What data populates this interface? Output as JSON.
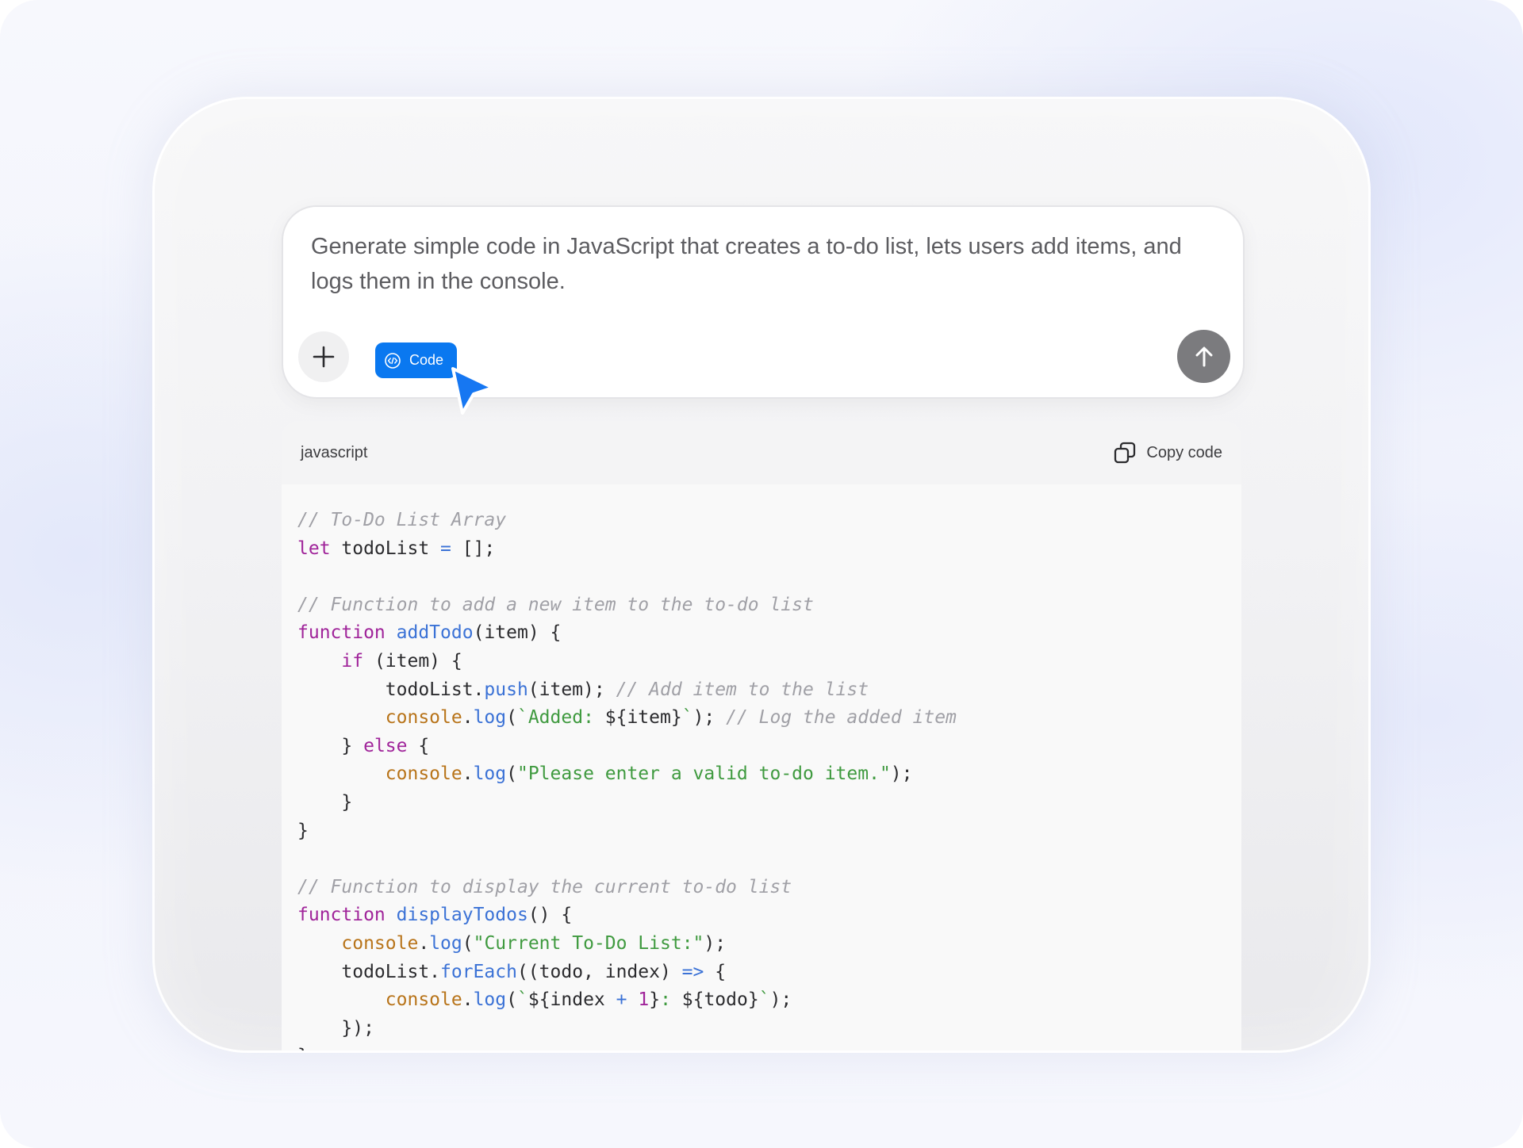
{
  "prompt": {
    "text": "Generate simple code in JavaScript that creates a to-do list, lets users add items, and logs them in the console."
  },
  "toolbar": {
    "chip_label": "Code"
  },
  "code_block": {
    "language": "javascript",
    "copy_label": "Copy code",
    "lines": [
      {
        "tokens": [
          {
            "t": "// To-Do List Array",
            "c": "cm"
          }
        ]
      },
      {
        "tokens": [
          {
            "t": "let",
            "c": "kw"
          },
          {
            "t": " todoList ",
            "c": ""
          },
          {
            "t": "=",
            "c": "op"
          },
          {
            "t": " [];",
            "c": ""
          }
        ]
      },
      {
        "tokens": []
      },
      {
        "tokens": [
          {
            "t": "// Function to add a new item to the to-do list",
            "c": "cm"
          }
        ]
      },
      {
        "tokens": [
          {
            "t": "function",
            "c": "kw"
          },
          {
            "t": " ",
            "c": ""
          },
          {
            "t": "addTodo",
            "c": "fn"
          },
          {
            "t": "(item) {",
            "c": ""
          }
        ]
      },
      {
        "tokens": [
          {
            "t": "    ",
            "c": ""
          },
          {
            "t": "if",
            "c": "kw"
          },
          {
            "t": " (item) {",
            "c": ""
          }
        ]
      },
      {
        "tokens": [
          {
            "t": "        todoList.",
            "c": ""
          },
          {
            "t": "push",
            "c": "fn"
          },
          {
            "t": "(item); ",
            "c": ""
          },
          {
            "t": "// Add item to the list",
            "c": "cm"
          }
        ]
      },
      {
        "tokens": [
          {
            "t": "        ",
            "c": ""
          },
          {
            "t": "console",
            "c": "ob"
          },
          {
            "t": ".",
            "c": ""
          },
          {
            "t": "log",
            "c": "fn"
          },
          {
            "t": "(",
            "c": ""
          },
          {
            "t": "`Added: ",
            "c": "st"
          },
          {
            "t": "${item}",
            "c": ""
          },
          {
            "t": "`",
            "c": "st"
          },
          {
            "t": "); ",
            "c": ""
          },
          {
            "t": "// Log the added item",
            "c": "cm"
          }
        ]
      },
      {
        "tokens": [
          {
            "t": "    } ",
            "c": ""
          },
          {
            "t": "else",
            "c": "kw"
          },
          {
            "t": " {",
            "c": ""
          }
        ]
      },
      {
        "tokens": [
          {
            "t": "        ",
            "c": ""
          },
          {
            "t": "console",
            "c": "ob"
          },
          {
            "t": ".",
            "c": ""
          },
          {
            "t": "log",
            "c": "fn"
          },
          {
            "t": "(",
            "c": ""
          },
          {
            "t": "\"Please enter a valid to-do item.\"",
            "c": "st"
          },
          {
            "t": ");",
            "c": ""
          }
        ]
      },
      {
        "tokens": [
          {
            "t": "    }",
            "c": ""
          }
        ]
      },
      {
        "tokens": [
          {
            "t": "}",
            "c": ""
          }
        ]
      },
      {
        "tokens": []
      },
      {
        "tokens": [
          {
            "t": "// Function to display the current to-do list",
            "c": "cm"
          }
        ]
      },
      {
        "tokens": [
          {
            "t": "function",
            "c": "kw"
          },
          {
            "t": " ",
            "c": ""
          },
          {
            "t": "displayTodos",
            "c": "fn"
          },
          {
            "t": "() {",
            "c": ""
          }
        ]
      },
      {
        "tokens": [
          {
            "t": "    ",
            "c": ""
          },
          {
            "t": "console",
            "c": "ob"
          },
          {
            "t": ".",
            "c": ""
          },
          {
            "t": "log",
            "c": "fn"
          },
          {
            "t": "(",
            "c": ""
          },
          {
            "t": "\"Current To-Do List:\"",
            "c": "st"
          },
          {
            "t": ");",
            "c": ""
          }
        ]
      },
      {
        "tokens": [
          {
            "t": "    todoList.",
            "c": ""
          },
          {
            "t": "forEach",
            "c": "fn"
          },
          {
            "t": "((todo, index) ",
            "c": ""
          },
          {
            "t": "=>",
            "c": "op"
          },
          {
            "t": " {",
            "c": ""
          }
        ]
      },
      {
        "tokens": [
          {
            "t": "        ",
            "c": ""
          },
          {
            "t": "console",
            "c": "ob"
          },
          {
            "t": ".",
            "c": ""
          },
          {
            "t": "log",
            "c": "fn"
          },
          {
            "t": "(",
            "c": ""
          },
          {
            "t": "`",
            "c": "st"
          },
          {
            "t": "${index ",
            "c": ""
          },
          {
            "t": "+",
            "c": "op"
          },
          {
            "t": " ",
            "c": ""
          },
          {
            "t": "1",
            "c": "nm"
          },
          {
            "t": "}",
            "c": ""
          },
          {
            "t": ": ",
            "c": "st"
          },
          {
            "t": "${todo}",
            "c": ""
          },
          {
            "t": "`",
            "c": "st"
          },
          {
            "t": ");",
            "c": ""
          }
        ]
      },
      {
        "tokens": [
          {
            "t": "    });",
            "c": ""
          }
        ]
      },
      {
        "tokens": [
          {
            "t": "}",
            "c": ""
          }
        ]
      }
    ]
  },
  "icons": {
    "plus": "plus-icon",
    "chip": "code-icon",
    "send": "arrow-up-icon",
    "copy": "copy-icon",
    "cursor": "mouse-pointer-icon"
  },
  "colors": {
    "accent": "#0a78f0",
    "send_button": "#7b7b7e",
    "keyword": "#a0249a",
    "function": "#3b72d6",
    "string": "#3f9a3f",
    "object": "#b8741a",
    "comment": "#a0a0a6"
  }
}
